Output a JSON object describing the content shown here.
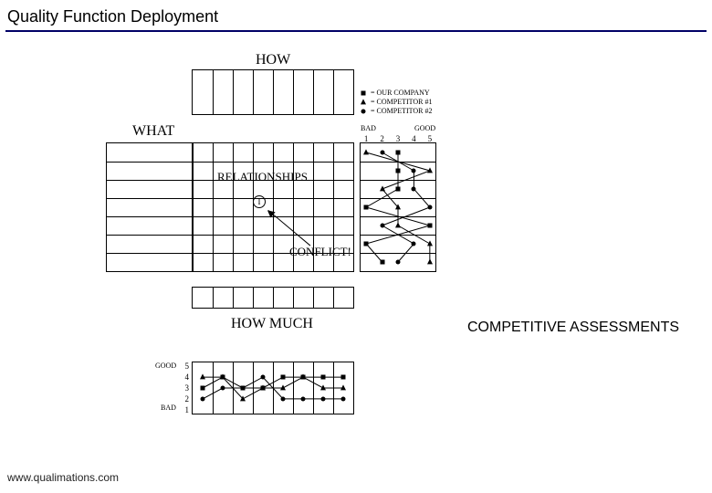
{
  "page": {
    "title": "Quality Function Deployment",
    "footer": "www.qualimations.com"
  },
  "diagram": {
    "labels": {
      "how": "HOW",
      "what": "WHAT",
      "relationships": "RELATIONSHIPS",
      "conflict": "CONFLICT!",
      "how_much": "HOW MUCH",
      "good": "GOOD",
      "bad": "BAD",
      "competitive_assessments": "COMPETITIVE ASSESSMENTS"
    },
    "legend": {
      "rows": [
        {
          "marker": "square",
          "text": "= OUR COMPANY"
        },
        {
          "marker": "triangle",
          "text": "= COMPETITOR #1"
        },
        {
          "marker": "circle",
          "text": "= COMPETITOR #2"
        }
      ]
    },
    "ring_label": "I",
    "right_chart": {
      "x_ticks": [
        "1",
        "2",
        "3",
        "4",
        "5"
      ],
      "bad_label": "BAD",
      "good_label": "GOOD"
    },
    "bottom_chart": {
      "y_ticks": [
        "5",
        "4",
        "3",
        "2",
        "1"
      ],
      "good_label": "GOOD",
      "bad_label": "BAD"
    }
  },
  "chart_data": {
    "right_panel": {
      "type": "line",
      "orientation": "vertical-categories",
      "categories_axis": "row",
      "x_range": [
        1,
        5
      ],
      "n_rows": 7,
      "series": [
        {
          "name": "OUR COMPANY",
          "marker": "square",
          "values": [
            3,
            3,
            3,
            1,
            5,
            1,
            2
          ]
        },
        {
          "name": "COMPETITOR #1",
          "marker": "triangle",
          "values": [
            1,
            5,
            2,
            3,
            3,
            5,
            5
          ]
        },
        {
          "name": "COMPETITOR #2",
          "marker": "circle",
          "values": [
            2,
            4,
            4,
            5,
            2,
            4,
            3
          ]
        }
      ]
    },
    "bottom_panel": {
      "type": "line",
      "orientation": "horizontal-categories",
      "categories_axis": "column",
      "y_range": [
        1,
        5
      ],
      "n_cols": 8,
      "series": [
        {
          "name": "OUR COMPANY",
          "marker": "square",
          "values": [
            3,
            4,
            3,
            3,
            4,
            4,
            4,
            4
          ]
        },
        {
          "name": "COMPETITOR #1",
          "marker": "triangle",
          "values": [
            4,
            4,
            2,
            3,
            3,
            4,
            3,
            3
          ]
        },
        {
          "name": "COMPETITOR #2",
          "marker": "circle",
          "values": [
            2,
            3,
            3,
            4,
            2,
            2,
            2,
            2
          ]
        }
      ]
    }
  }
}
